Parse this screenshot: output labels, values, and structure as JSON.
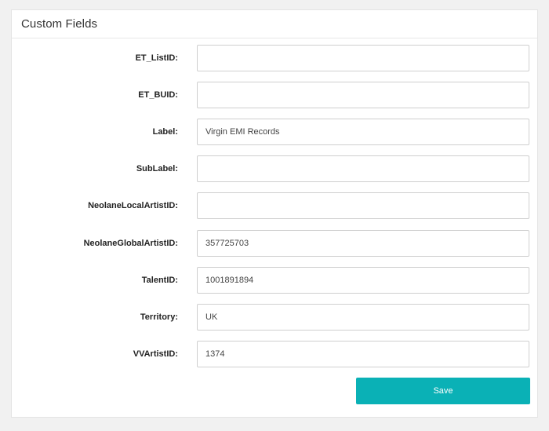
{
  "panel": {
    "title": "Custom Fields"
  },
  "fields": [
    {
      "label": "ET_ListID:",
      "value": ""
    },
    {
      "label": "ET_BUID:",
      "value": ""
    },
    {
      "label": "Label:",
      "value": "Virgin EMI Records"
    },
    {
      "label": "SubLabel:",
      "value": ""
    },
    {
      "label": "NeolaneLocalArtistID:",
      "value": ""
    },
    {
      "label": "NeolaneGlobalArtistID:",
      "value": "357725703"
    },
    {
      "label": "TalentID:",
      "value": "1001891894"
    },
    {
      "label": "Territory:",
      "value": "UK"
    },
    {
      "label": "VVArtistID:",
      "value": "1374"
    }
  ],
  "actions": {
    "save_label": "Save"
  },
  "colors": {
    "accent": "#0ab1b6",
    "background": "#f1f1f1"
  }
}
